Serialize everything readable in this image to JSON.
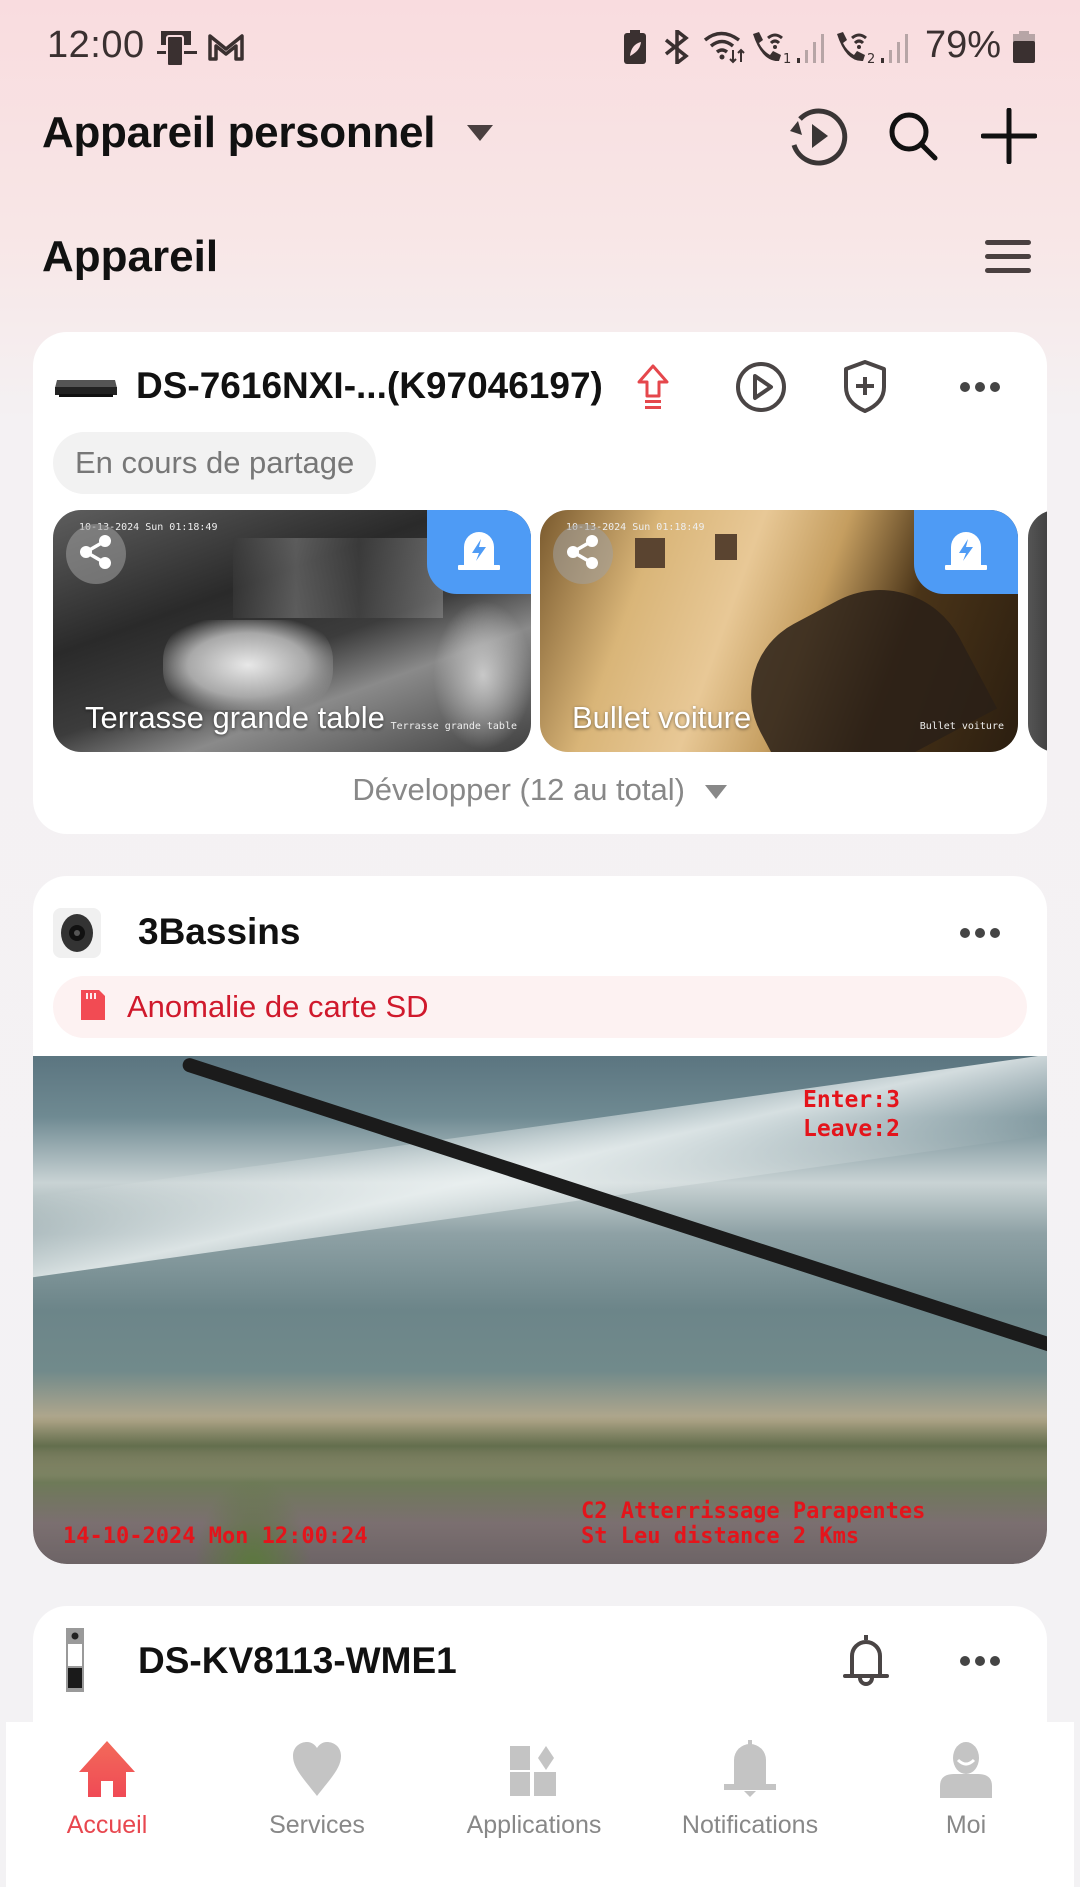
{
  "status_bar": {
    "time": "12:00",
    "battery_percent": "79%",
    "left_icons": [
      "screen-mirror-icon",
      "gmail-icon"
    ],
    "right_icons": [
      "battery-saver-icon",
      "bluetooth-icon",
      "wifi-icon",
      "wifi-call-sim1-icon",
      "signal-sim1-icon",
      "wifi-call-sim2-icon",
      "signal-sim2-icon",
      "battery-icon"
    ]
  },
  "header": {
    "title": "Appareil personnel",
    "actions": [
      "playback-icon",
      "search-icon",
      "add-icon"
    ]
  },
  "section": {
    "title": "Appareil"
  },
  "devices": [
    {
      "name": "DS-7616NXI-...(K97046197)",
      "chip": "En cours de partage",
      "actions": [
        "upgrade-icon",
        "play-icon",
        "security-shield-icon",
        "more-icon"
      ],
      "channels": [
        {
          "label": "Terrasse grande table",
          "osd_timestamp": "10-13-2024 Sun 01:18:49",
          "osd_name": "Terrasse grande table"
        },
        {
          "label": "Bullet voiture",
          "osd_timestamp": "10-13-2024 Sun 01:18:49",
          "osd_name": "Bullet voiture"
        }
      ],
      "expand_label": "Développer (12 au total)"
    },
    {
      "name": "3Bassins",
      "alert": "Anomalie de carte SD",
      "osd": {
        "enter": "Enter:3",
        "leave": "Leave:2",
        "timestamp": "14-10-2024 Mon 12:00:24",
        "caption_line1": "C2 Atterrissage Parapentes",
        "caption_line2": "St Leu distance 2 Kms"
      }
    },
    {
      "name": "DS-KV8113-WME1",
      "actions": [
        "bell-icon",
        "more-icon"
      ]
    }
  ],
  "bottom_nav": [
    {
      "label": "Accueil",
      "icon": "home-icon",
      "active": true
    },
    {
      "label": "Services",
      "icon": "heart-icon",
      "active": false
    },
    {
      "label": "Applications",
      "icon": "apps-icon",
      "active": false
    },
    {
      "label": "Notifications",
      "icon": "bell-icon",
      "active": false
    },
    {
      "label": "Moi",
      "icon": "profile-icon",
      "active": false
    }
  ],
  "colors": {
    "accent": "#e8474f",
    "alarm_badge": "#4e9bf5",
    "alert_text": "#d0192c",
    "osd_red": "#e4141b"
  }
}
